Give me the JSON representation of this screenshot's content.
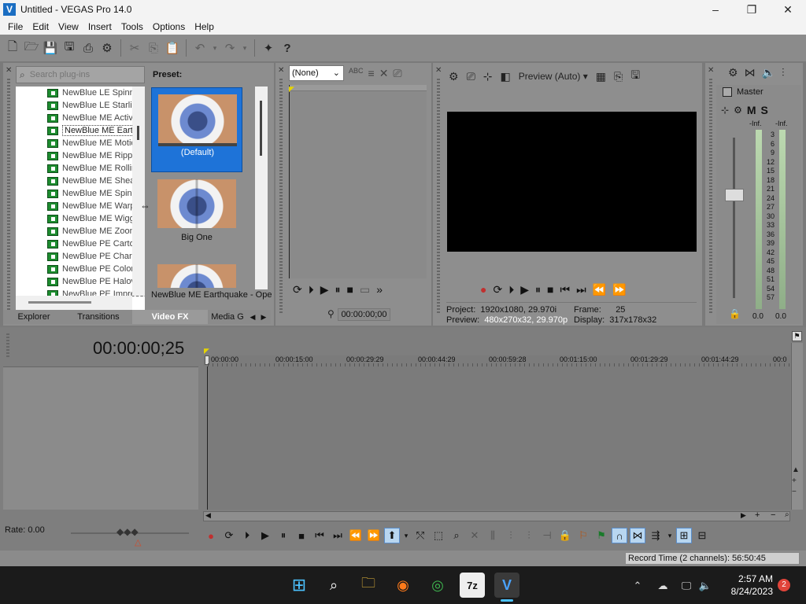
{
  "window": {
    "title": "Untitled - VEGAS Pro 14.0",
    "app_icon": "vegas-icon",
    "minimize": "–",
    "maximize": "❐",
    "close": "✕"
  },
  "menu": [
    "File",
    "Edit",
    "View",
    "Insert",
    "Tools",
    "Options",
    "Help"
  ],
  "toolbar": {
    "icons": [
      "new-icon",
      "open-icon",
      "save-icon",
      "save-as-icon",
      "render-icon",
      "properties-icon",
      "cut-icon",
      "copy-icon",
      "paste-icon",
      "undo-icon",
      "redo-icon",
      "enable-snapping-icon",
      "help-icon"
    ],
    "help_label": "?"
  },
  "explorer": {
    "search_placeholder": "Search plug-ins",
    "plugins": [
      "NewBlue LE Spinning",
      "NewBlue LE Starlight",
      "NewBlue ME Active",
      "NewBlue ME Earthquake",
      "NewBlue ME Motion",
      "NewBlue ME Ripple",
      "NewBlue ME Rolling",
      "NewBlue ME Shear",
      "NewBlue ME Spin",
      "NewBlue ME Warp",
      "NewBlue ME Wiggle",
      "NewBlue ME Zoom",
      "NewBlue PE Cartoon",
      "NewBlue PE Charcoal",
      "NewBlue PE Colorize",
      "NewBlue PE Halovision",
      "NewBlue PE Impressionist"
    ],
    "selected_index": 3,
    "preset_header": "Preset:",
    "presets": [
      "(Default)",
      "Big One"
    ],
    "preset_status": "NewBlue ME Earthquake - Ope",
    "tabs": [
      "Explorer",
      "Transitions",
      "Video FX",
      "Media G"
    ],
    "active_tab": "Video FX"
  },
  "trimmer": {
    "select_value": "(None)",
    "timecode": "00:00:00;00"
  },
  "preview": {
    "mode_label": "Preview (Auto)",
    "project_label": "Project:",
    "project_value": "1920x1080, 29.970i",
    "preview_label": "Preview:",
    "preview_value": "480x270x32, 29.970p",
    "frame_label": "Frame:",
    "frame_value": "25",
    "display_label": "Display:",
    "display_value": "317x178x32"
  },
  "mixer": {
    "master_label": "Master",
    "m_label": "M",
    "s_label": "S",
    "inf_left": "-Inf.",
    "inf_right": "-Inf.",
    "scale": [
      "3",
      "6",
      "9",
      "12",
      "15",
      "18",
      "21",
      "24",
      "27",
      "30",
      "33",
      "36",
      "39",
      "42",
      "45",
      "48",
      "51",
      "54",
      "57"
    ],
    "level_left": "0.0",
    "level_right": "0.0"
  },
  "timeline": {
    "time_display": "00:00:00;25",
    "ruler": [
      "00:00:00",
      "00:00:15:00",
      "00:00:29:29",
      "00:00:44:29",
      "00:00:59:28",
      "00:01:15:00",
      "00:01:29:29",
      "00:01:44:29",
      "00:0"
    ],
    "rate_label": "Rate: 0.00"
  },
  "status": {
    "record_time": "Record Time (2 channels): 56:50:45"
  },
  "taskbar": {
    "time": "2:57 AM",
    "date": "8/24/2023",
    "notification_count": "2",
    "zip_label": "7z"
  }
}
